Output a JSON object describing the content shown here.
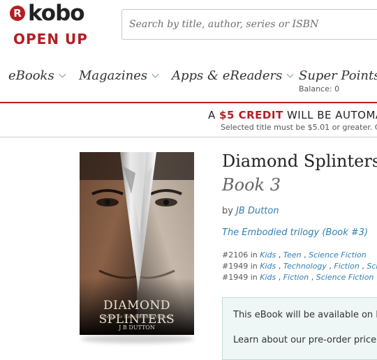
{
  "brand": {
    "logo_letter": "R",
    "name": "kobo",
    "tagline": "OPEN UP"
  },
  "search": {
    "placeholder": "Search by title, author, series or ISBN"
  },
  "nav": {
    "items": [
      {
        "label": "eBooks"
      },
      {
        "label": "Magazines"
      },
      {
        "label": "Apps & eReaders"
      },
      {
        "label": "Super Points"
      }
    ],
    "balance": "Balance: 0"
  },
  "promo": {
    "prefix": "A ",
    "credit": "$5 CREDIT",
    "suffix": " WILL BE AUTOMA",
    "subtext": "Selected title must be $5.01 or greater. C"
  },
  "book": {
    "title": "Diamond Splinters",
    "subtitle": "Book 3",
    "by_label": "by ",
    "author": "JB Dutton",
    "series": "The Embodied trilogy (Book #3)",
    "cover_title": "DIAMOND SPLINTERS",
    "cover_subtitle": "BOOK 3 OF THE EMBODIED TRILOGY",
    "cover_author": "J B DUTTON",
    "ranks": [
      {
        "rank": "#2106",
        "in": " in ",
        "cats": [
          "Kids",
          "Teen",
          "Science Fiction"
        ]
      },
      {
        "rank": "#1949",
        "in": " in ",
        "cats": [
          "Kids",
          "Technology",
          "Fiction",
          "Sci"
        ]
      },
      {
        "rank": "#1949",
        "in": " in ",
        "cats": [
          "Kids",
          "Fiction",
          "Science Fiction"
        ]
      }
    ]
  },
  "availability": {
    "text": "This eBook will be available on M",
    "learn": "Learn about our pre-order price"
  },
  "colors": {
    "brand_red": "#b41e24",
    "link_blue": "#2f7fb5"
  }
}
